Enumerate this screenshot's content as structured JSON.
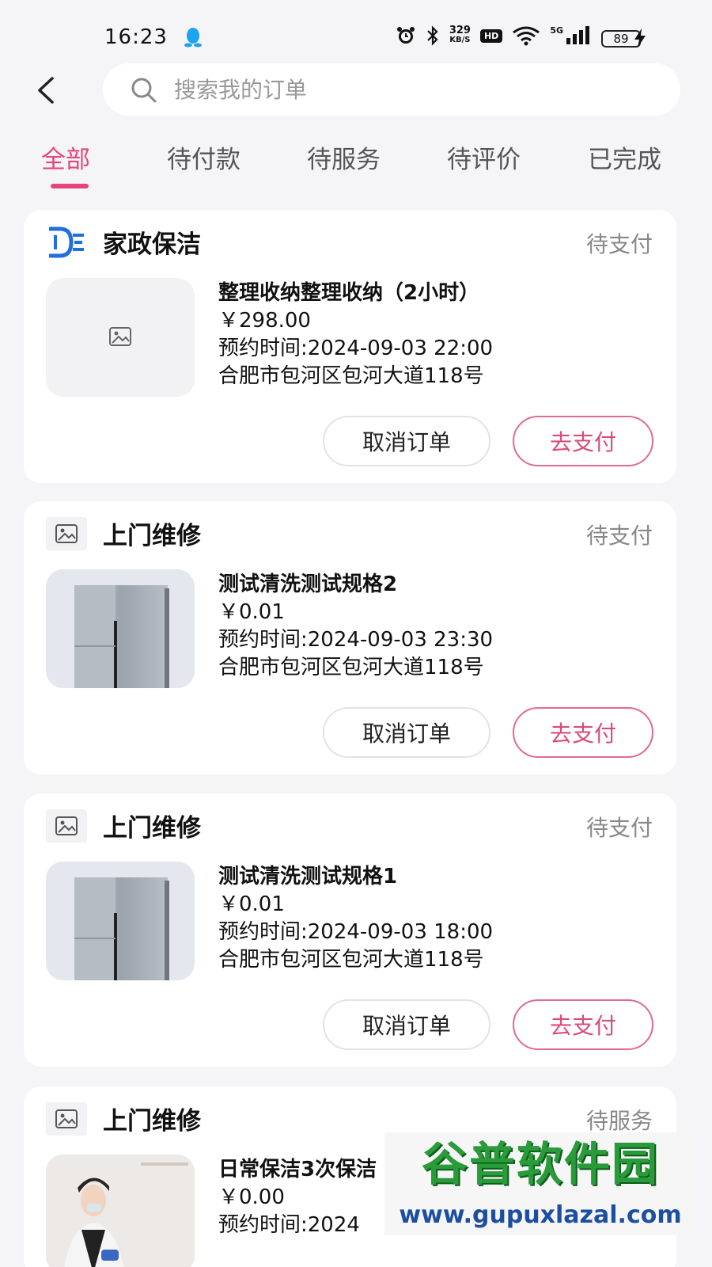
{
  "status_bar": {
    "time": "16:23",
    "net_speed_value": "329",
    "net_speed_unit": "KB/S",
    "hd_label": "HD",
    "net_type": "5G",
    "battery": "89"
  },
  "search": {
    "placeholder": "搜索我的订单"
  },
  "tabs": [
    {
      "label": "全部",
      "active": true
    },
    {
      "label": "待付款",
      "active": false
    },
    {
      "label": "待服务",
      "active": false
    },
    {
      "label": "待评价",
      "active": false
    },
    {
      "label": "已完成",
      "active": false
    }
  ],
  "colors": {
    "accent": "#e8437a",
    "pay_border": "#e06a92",
    "background": "#f5f5f7"
  },
  "orders": [
    {
      "shop_name": "家政保洁",
      "shop_icon": "de-logo-icon",
      "status": "待支付",
      "thumb_icon": "image-placeholder-icon",
      "title": "整理收纳整理收纳（2小时）",
      "price": "￥298.00",
      "time": "预约时间:2024-09-03 22:00",
      "address": "合肥市包河区包河大道118号",
      "cancel_label": "取消订单",
      "pay_label": "去支付"
    },
    {
      "shop_name": "上门维修",
      "shop_icon": "image-placeholder-icon",
      "status": "待支付",
      "thumb_icon": "fridge-image",
      "title": "测试清洗测试规格2",
      "price": "￥0.01",
      "time": "预约时间:2024-09-03 23:30",
      "address": "合肥市包河区包河大道118号",
      "cancel_label": "取消订单",
      "pay_label": "去支付"
    },
    {
      "shop_name": "上门维修",
      "shop_icon": "image-placeholder-icon",
      "status": "待支付",
      "thumb_icon": "fridge-image",
      "title": "测试清洗测试规格1",
      "price": "￥0.01",
      "time": "预约时间:2024-09-03 18:00",
      "address": "合肥市包河区包河大道118号",
      "cancel_label": "取消订单",
      "pay_label": "去支付"
    },
    {
      "shop_name": "上门维修",
      "shop_icon": "image-placeholder-icon",
      "status": "待服务",
      "thumb_icon": "cleaning-photo",
      "title": "日常保洁3次保洁",
      "price": "￥0.00",
      "time": "预约时间:2024"
    }
  ],
  "watermark": {
    "logo_text": "谷普软件园",
    "url": "www.gupuxlazal.com"
  }
}
